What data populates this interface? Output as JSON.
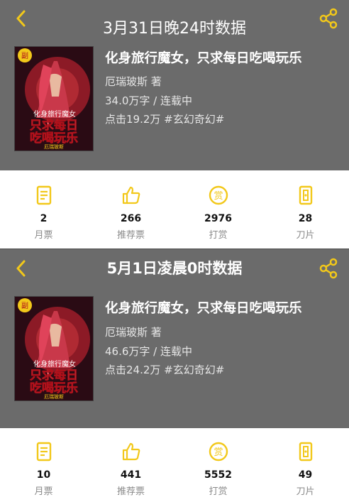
{
  "colors": {
    "accent": "#f2c81a",
    "header_bg": "#6b6b6b"
  },
  "panels": [
    {
      "title": "3月31日晚24时数据",
      "book": {
        "title": "化身旅行魔女，只求每日吃喝玩乐",
        "author": "厄瑞玻斯 著",
        "words": "34.0万字 / 连载中",
        "clicks": "点击19.2万 #玄幻奇幻#"
      },
      "stats": [
        {
          "icon": "ticket-icon",
          "value": "2",
          "label": "月票"
        },
        {
          "icon": "thumbs-up-icon",
          "value": "266",
          "label": "推荐票"
        },
        {
          "icon": "reward-coin-icon",
          "value": "2976",
          "label": "打赏"
        },
        {
          "icon": "blade-icon",
          "value": "28",
          "label": "刀片"
        }
      ]
    },
    {
      "title": "5月1日凌晨0时数据",
      "book": {
        "title": "化身旅行魔女，只求每日吃喝玩乐",
        "author": "厄瑞玻斯 著",
        "words": "46.6万字 / 连载中",
        "clicks": "点击24.2万 #玄幻奇幻#"
      },
      "stats": [
        {
          "icon": "ticket-icon",
          "value": "10",
          "label": "月票"
        },
        {
          "icon": "thumbs-up-icon",
          "value": "441",
          "label": "推荐票"
        },
        {
          "icon": "reward-coin-icon",
          "value": "5552",
          "label": "打赏"
        },
        {
          "icon": "blade-icon",
          "value": "49",
          "label": "刀片"
        }
      ]
    }
  ],
  "cover": {
    "badge": "副",
    "line1": "化身旅行魔女",
    "line2": "只求每日",
    "line3": "吃喝玩乐",
    "author_tag": "厄瑞玻斯"
  },
  "reward_char": "赏"
}
